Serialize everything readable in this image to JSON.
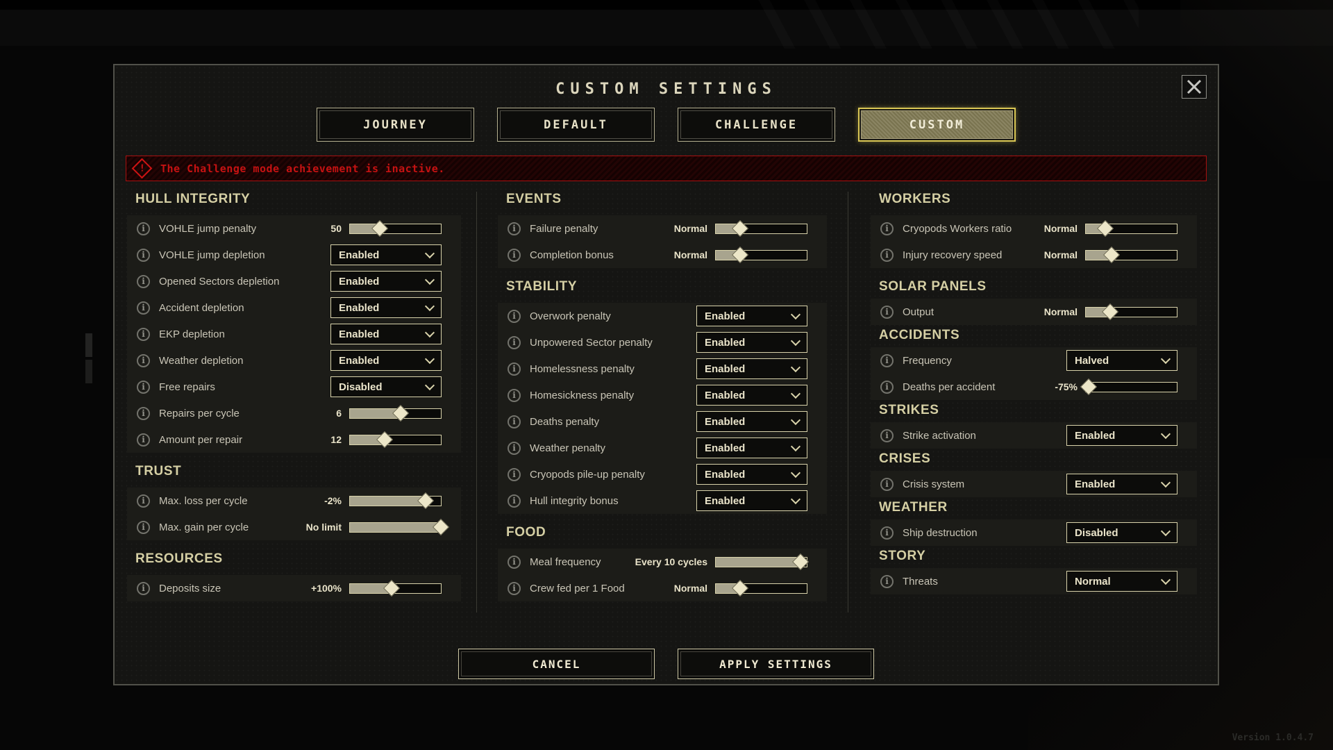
{
  "window": {
    "title": "CUSTOM SETTINGS",
    "version": "Version 1.0.4.7"
  },
  "tabs": [
    {
      "label": "JOURNEY",
      "selected": false
    },
    {
      "label": "DEFAULT",
      "selected": false
    },
    {
      "label": "CHALLENGE",
      "selected": false
    },
    {
      "label": "CUSTOM",
      "selected": true
    }
  ],
  "warning": {
    "icon": "warning-diamond",
    "exclamation": "!",
    "text": "The Challenge mode achievement is inactive."
  },
  "columns": [
    {
      "sections": [
        {
          "title": "HULL INTEGRITY",
          "rows": [
            {
              "label": "VOHLE jump penalty",
              "type": "slider",
              "value": "50",
              "fill": 33
            },
            {
              "label": "VOHLE jump depletion",
              "type": "select",
              "value": "Enabled"
            },
            {
              "label": "Opened Sectors depletion",
              "type": "select",
              "value": "Enabled"
            },
            {
              "label": "Accident depletion",
              "type": "select",
              "value": "Enabled"
            },
            {
              "label": "EKP depletion",
              "type": "select",
              "value": "Enabled"
            },
            {
              "label": "Weather depletion",
              "type": "select",
              "value": "Enabled"
            },
            {
              "label": "Free repairs",
              "type": "select",
              "value": "Disabled"
            },
            {
              "label": "Repairs per cycle",
              "type": "slider",
              "value": "6",
              "fill": 56
            },
            {
              "label": "Amount per repair",
              "type": "slider",
              "value": "12",
              "fill": 38
            }
          ]
        },
        {
          "title": "TRUST",
          "rows": [
            {
              "label": "Max. loss per cycle",
              "type": "slider",
              "value": "-2%",
              "fill": 83
            },
            {
              "label": "Max. gain per cycle",
              "type": "slider",
              "value": "No limit",
              "fill": 100
            }
          ]
        },
        {
          "title": "RESOURCES",
          "rows": [
            {
              "label": "Deposits size",
              "type": "slider",
              "value": "+100%",
              "fill": 46
            }
          ]
        }
      ]
    },
    {
      "sections": [
        {
          "title": "EVENTS",
          "rows": [
            {
              "label": "Failure penalty",
              "type": "slider",
              "value": "Normal",
              "fill": 27
            },
            {
              "label": "Completion bonus",
              "type": "slider",
              "value": "Normal",
              "fill": 27
            }
          ]
        },
        {
          "title": "STABILITY",
          "rows": [
            {
              "label": "Overwork penalty",
              "type": "select",
              "value": "Enabled"
            },
            {
              "label": "Unpowered Sector penalty",
              "type": "select",
              "value": "Enabled"
            },
            {
              "label": "Homelessness penalty",
              "type": "select",
              "value": "Enabled"
            },
            {
              "label": "Homesickness penalty",
              "type": "select",
              "value": "Enabled"
            },
            {
              "label": "Deaths penalty",
              "type": "select",
              "value": "Enabled"
            },
            {
              "label": "Weather penalty",
              "type": "select",
              "value": "Enabled"
            },
            {
              "label": "Cryopods pile-up penalty",
              "type": "select",
              "value": "Enabled"
            },
            {
              "label": "Hull integrity bonus",
              "type": "select",
              "value": "Enabled"
            }
          ]
        },
        {
          "title": "FOOD",
          "rows": [
            {
              "label": "Meal frequency",
              "type": "slider",
              "value": "Every 10 cycles",
              "fill": 93
            },
            {
              "label": "Crew fed per 1 Food",
              "type": "slider",
              "value": "Normal",
              "fill": 27
            }
          ]
        }
      ]
    },
    {
      "sections": [
        {
          "title": "WORKERS",
          "rows": [
            {
              "label": "Cryopods Workers ratio",
              "type": "slider",
              "value": "Normal",
              "fill": 21
            },
            {
              "label": "Injury recovery speed",
              "type": "slider",
              "value": "Normal",
              "fill": 28
            }
          ]
        },
        {
          "title": "SOLAR PANELS",
          "rows": [
            {
              "label": "Output",
              "type": "slider",
              "value": "Normal",
              "fill": 27
            }
          ]
        },
        {
          "title": "ACCIDENTS",
          "rows": [
            {
              "label": "Frequency",
              "type": "select",
              "value": "Halved"
            },
            {
              "label": "Deaths per accident",
              "type": "slider",
              "value": "-75%",
              "fill": 3
            }
          ]
        },
        {
          "title": "STRIKES",
          "rows": [
            {
              "label": "Strike activation",
              "type": "select",
              "value": "Enabled"
            }
          ]
        },
        {
          "title": "CRISES",
          "rows": [
            {
              "label": "Crisis system",
              "type": "select",
              "value": "Enabled"
            }
          ]
        },
        {
          "title": "WEATHER",
          "rows": [
            {
              "label": "Ship destruction",
              "type": "select",
              "value": "Disabled"
            }
          ]
        },
        {
          "title": "STORY",
          "rows": [
            {
              "label": "Threats",
              "type": "select",
              "value": "Normal"
            }
          ]
        }
      ]
    }
  ],
  "footer": {
    "cancel_label": "CANCEL",
    "apply_label": "APPLY SETTINGS"
  },
  "colors": {
    "accent_cream": "#e9e3c9",
    "section_title": "#d5cfa4",
    "warning_red": "#c61212",
    "selected_tab_gold": "#d9c654",
    "slider_fill": "#a8a48e",
    "panel_bg": "#1c1c18"
  }
}
